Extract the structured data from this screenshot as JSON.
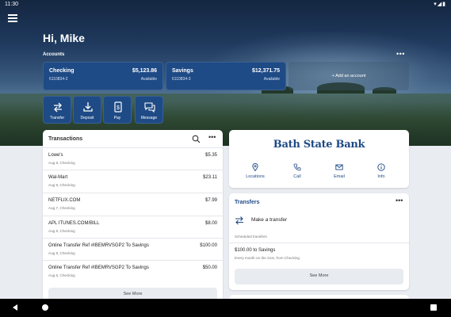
{
  "status_bar": {
    "time": "11:30",
    "icons": "▾◢▮"
  },
  "header": {
    "greeting": "Hi, Mike",
    "accounts_label": "Accounts",
    "accounts_more": "•••"
  },
  "accounts": [
    {
      "name": "Checking",
      "number": "6110834-2",
      "balance": "$5,123.86",
      "available_label": "Available"
    },
    {
      "name": "Savings",
      "number": "6110834-3",
      "balance": "$12,371.75",
      "available_label": "Available"
    }
  ],
  "add_account_label": "+ Add an account",
  "actions": [
    {
      "label": "Transfer",
      "icon": "transfer-icon"
    },
    {
      "label": "Deposit",
      "icon": "deposit-icon"
    },
    {
      "label": "Pay",
      "icon": "pay-icon"
    },
    {
      "label": "Message",
      "icon": "message-icon"
    }
  ],
  "transactions": {
    "title": "Transactions",
    "more": "•••",
    "items": [
      {
        "description": "Lowe's",
        "sub": "Aug 8, Checking",
        "amount": "$5.35"
      },
      {
        "description": "Wal-Mart",
        "sub": "Aug 8, Checking",
        "amount": "$23.11"
      },
      {
        "description": "NETFLIX.COM",
        "sub": "Aug 7, Checking",
        "amount": "$7.99"
      },
      {
        "description": "APL ITUNES.COM/BILL",
        "sub": "Aug 8, Checking",
        "amount": "$8.00"
      },
      {
        "description": "Online Transfer Ref #IBEMRVSGP2 To Savings",
        "sub": "Aug 8, Checking",
        "amount": "$100.00"
      },
      {
        "description": "Online Transfer Ref #IBEMRVSGP2 To Savings",
        "sub": "Aug 6, Checking",
        "amount": "$50.00"
      }
    ],
    "see_more": "See More"
  },
  "bank": {
    "name": "Bath State Bank",
    "contacts": [
      {
        "label": "Locations",
        "icon": "location-pin-icon"
      },
      {
        "label": "Call",
        "icon": "phone-icon"
      },
      {
        "label": "Email",
        "icon": "email-icon"
      },
      {
        "label": "Info",
        "icon": "info-icon"
      }
    ]
  },
  "transfers": {
    "title": "Transfers",
    "more": "•••",
    "make_transfer": "Make a transfer",
    "scheduled_label": "Scheduled transfers",
    "scheduled": [
      {
        "amount_desc": "$100.00 to Savings",
        "detail": "Every month on the 21st, from Checking"
      }
    ],
    "see_more": "See More"
  },
  "colors": {
    "brand": "#1e4a85",
    "card": "#ffffff",
    "page": "#e9ecf1"
  }
}
